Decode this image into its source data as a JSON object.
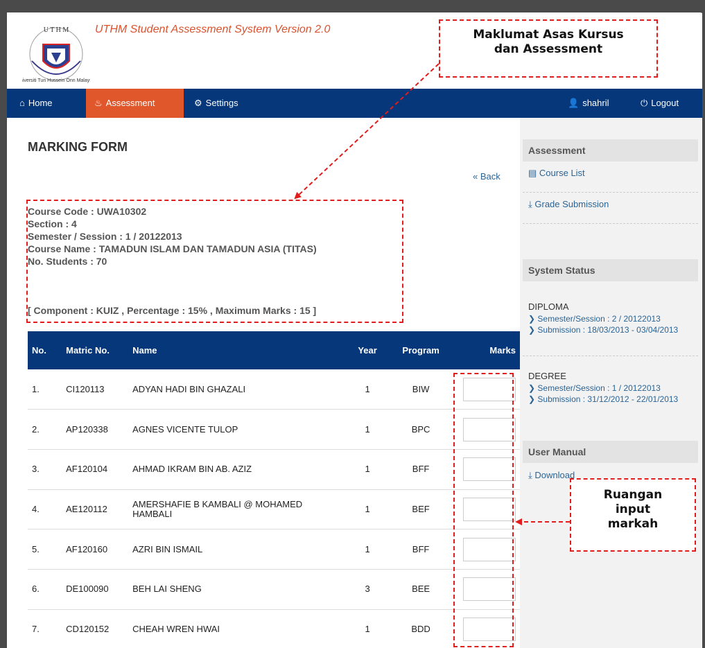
{
  "app": {
    "title": "UTHM Student Assessment System Version 2.0",
    "logo_text": "Universiti Tun Hussein Onn Malaysia",
    "logo_letters": "U T H M"
  },
  "nav": {
    "home": "Home",
    "assessment": "Assessment",
    "settings": "Settings",
    "user": "shahril",
    "logout": "Logout"
  },
  "page": {
    "title": "MARKING FORM",
    "back": "« Back"
  },
  "course": {
    "code_line": "Course Code : UWA10302",
    "section_line": "Section : 4",
    "semester_line": "Semester / Session : 1 / 20122013",
    "name_line": "Course Name : TAMADUN ISLAM DAN TAMADUN ASIA (TITAS)",
    "students_line": "No. Students : 70",
    "component_line": "[ Component : KUIZ , Percentage : 15% , Maximum Marks : 15 ]"
  },
  "table": {
    "headers": {
      "no": "No.",
      "matric": "Matric No.",
      "name": "Name",
      "year": "Year",
      "program": "Program",
      "marks": "Marks"
    },
    "rows": [
      {
        "no": "1.",
        "matric": "CI120113",
        "name": "ADYAN HADI BIN GHAZALI",
        "year": "1",
        "program": "BIW",
        "marks": ""
      },
      {
        "no": "2.",
        "matric": "AP120338",
        "name": "AGNES VICENTE TULOP",
        "year": "1",
        "program": "BPC",
        "marks": ""
      },
      {
        "no": "3.",
        "matric": "AF120104",
        "name": "AHMAD IKRAM BIN AB. AZIZ",
        "year": "1",
        "program": "BFF",
        "marks": ""
      },
      {
        "no": "4.",
        "matric": "AE120112",
        "name": "AMERSHAFIE B KAMBALI @ MOHAMED HAMBALI",
        "year": "1",
        "program": "BEF",
        "marks": ""
      },
      {
        "no": "5.",
        "matric": "AF120160",
        "name": "AZRI BIN ISMAIL",
        "year": "1",
        "program": "BFF",
        "marks": ""
      },
      {
        "no": "6.",
        "matric": "DE100090",
        "name": "BEH LAI SHENG",
        "year": "3",
        "program": "BEE",
        "marks": ""
      },
      {
        "no": "7.",
        "matric": "CD120152",
        "name": "CHEAH WREN HWAI",
        "year": "1",
        "program": "BDD",
        "marks": ""
      }
    ]
  },
  "sidebar": {
    "assessment_head": "Assessment",
    "course_list": "Course List",
    "grade_submission": "Grade Submission",
    "status_head": "System Status",
    "diploma": "DIPLOMA",
    "diploma_semester": "Semester/Session : 2 / 20122013",
    "diploma_submission": "Submission : 18/03/2013 - 03/04/2013",
    "degree": "DEGREE",
    "degree_semester": "Semester/Session : 1 / 20122013",
    "degree_submission": "Submission : 31/12/2012 - 22/01/2013",
    "manual_head": "User Manual",
    "download": "Download"
  },
  "annotations": {
    "top_line1": "Maklumat Asas Kursus",
    "top_line2": "dan Assessment",
    "right_line1": "Ruangan",
    "right_line2": "input",
    "right_line3": "markah",
    "color": "#e21b1b"
  },
  "icons": {
    "home": "home-icon",
    "assessment": "fire-icon",
    "settings": "gear-icon",
    "user": "user-icon",
    "logout": "power-icon",
    "course_list": "list-icon",
    "grade_submission": "download-icon",
    "bullet": "chevron-right-icon"
  },
  "colors": {
    "nav_bg": "#05377a",
    "nav_active": "#e0572c",
    "title_orange": "#d9532e",
    "link_blue": "#2a6496"
  }
}
